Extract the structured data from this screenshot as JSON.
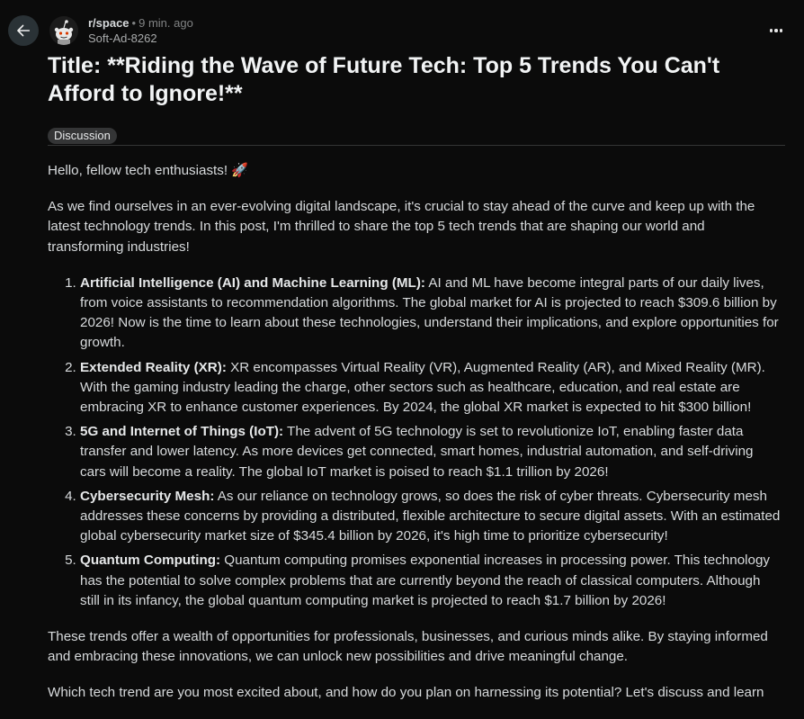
{
  "header": {
    "subreddit": "r/space",
    "separator": "•",
    "time": "9 min. ago",
    "author": "Soft-Ad-8262"
  },
  "post": {
    "title": "Title: **Riding the Wave of Future Tech: Top 5 Trends You Can't Afford to Ignore!**",
    "flair": "Discussion",
    "greeting": "Hello, fellow tech enthusiasts! 🚀",
    "intro": "As we find ourselves in an ever-evolving digital landscape, it's crucial to stay ahead of the curve and keep up with the latest technology trends. In this post, I'm thrilled to share the top 5 tech trends that are shaping our world and transforming industries!",
    "trends": [
      {
        "heading": "Artificial Intelligence (AI) and Machine Learning (ML):",
        "text": " AI and ML have become integral parts of our daily lives, from voice assistants to recommendation algorithms. The global market for AI is projected to reach $309.6 billion by 2026! Now is the time to learn about these technologies, understand their implications, and explore opportunities for growth."
      },
      {
        "heading": "Extended Reality (XR):",
        "text": " XR encompasses Virtual Reality (VR), Augmented Reality (AR), and Mixed Reality (MR). With the gaming industry leading the charge, other sectors such as healthcare, education, and real estate are embracing XR to enhance customer experiences. By 2024, the global XR market is expected to hit $300 billion!"
      },
      {
        "heading": "5G and Internet of Things (IoT):",
        "text": " The advent of 5G technology is set to revolutionize IoT, enabling faster data transfer and lower latency. As more devices get connected, smart homes, industrial automation, and self-driving cars will become a reality. The global IoT market is poised to reach $1.1 trillion by 2026!"
      },
      {
        "heading": "Cybersecurity Mesh:",
        "text": " As our reliance on technology grows, so does the risk of cyber threats. Cybersecurity mesh addresses these concerns by providing a distributed, flexible architecture to secure digital assets. With an estimated global cybersecurity market size of $345.4 billion by 2026, it's high time to prioritize cybersecurity!"
      },
      {
        "heading": "Quantum Computing:",
        "text": " Quantum computing promises exponential increases in processing power. This technology has the potential to solve complex problems that are currently beyond the reach of classical computers. Although still in its infancy, the global quantum computing market is projected to reach $1.7 billion by 2026!"
      }
    ],
    "conclusion": "These trends offer a wealth of opportunities for professionals, businesses, and curious minds alike. By staying informed and embracing these innovations, we can unlock new possibilities and drive meaningful change.",
    "closing": "Which tech trend are you most excited about, and how do you plan on harnessing its potential? Let's discuss and learn"
  },
  "icons": {
    "back": "arrow-left-icon",
    "more": "more-horizontal-icon",
    "avatar": "reddit-snoo-avatar"
  },
  "colors": {
    "background": "#0b0b0b",
    "text": "#d7dadc",
    "muted": "#818384",
    "flair_bg": "#343536",
    "back_button_bg": "#2a3236"
  }
}
